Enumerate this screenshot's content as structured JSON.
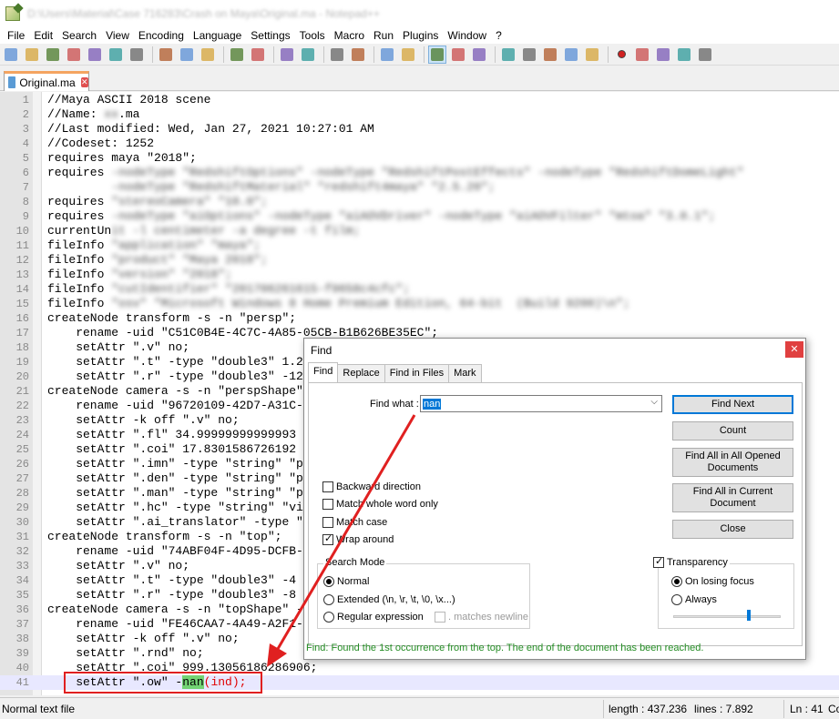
{
  "window": {
    "title": "D:\\Users\\Material\\Case 716283\\Crash on Maya\\Original.ma - Notepad++"
  },
  "menu": [
    "File",
    "Edit",
    "Search",
    "View",
    "Encoding",
    "Language",
    "Settings",
    "Tools",
    "Macro",
    "Run",
    "Plugins",
    "Window",
    "?"
  ],
  "toolbar": {
    "icons": [
      "new-file-icon",
      "open-file-icon",
      "save-icon",
      "save-all-icon",
      "close-icon",
      "close-all-icon",
      "print-icon",
      "cut-icon",
      "copy-icon",
      "paste-icon",
      "undo-icon",
      "redo-icon",
      "find-icon",
      "replace-icon",
      "zoom-in-icon",
      "zoom-out-icon",
      "sync-vertical-icon",
      "sync-horizontal-icon",
      "word-wrap-icon",
      "show-all-chars-icon",
      "indent-guide-icon",
      "udl-icon",
      "doc-map-icon",
      "function-list-icon",
      "folder-workspace-icon",
      "monitoring-icon",
      "record-macro-icon",
      "stop-record-icon",
      "play-macro-icon",
      "run-macro-multiple-icon",
      "save-macro-icon"
    ]
  },
  "tab": {
    "label": "Original.ma"
  },
  "editor": {
    "lines": [
      {
        "n": "1",
        "t": "//Maya ASCII 2018 scene"
      },
      {
        "n": "2",
        "t": "//Name: ",
        "b": "xx",
        "a": ".ma"
      },
      {
        "n": "3",
        "t": "//Last modified: Wed, Jan 27, 2021 10:27:01 AM"
      },
      {
        "n": "4",
        "t": "//Codeset: 1252"
      },
      {
        "n": "5",
        "t": "requires maya \"2018\";"
      },
      {
        "n": "6",
        "t": "requires ",
        "b": "-nodeType \"RedshiftOptions\" -nodeType \"RedshiftPostEffects\" -nodeType \"RedshiftDomeLight\""
      },
      {
        "n": "7",
        "t": "         ",
        "b": "-nodeType \"RedshiftMaterial\" \"redshift4maya\" \"2.5.20\";"
      },
      {
        "n": "8",
        "t": "requires ",
        "b": "\"stereoCamera\" \"10.0\";"
      },
      {
        "n": "9",
        "t": "requires ",
        "b": "-nodeType \"aiOptions\" -nodeType \"aiAOVDriver\" -nodeType \"aiAOVFilter\" \"mtoa\" \"3.0.1\";"
      },
      {
        "n": "10",
        "t": "currentUn",
        "b": "it -l centimeter -a degree -t film;"
      },
      {
        "n": "11",
        "t": "fileInfo ",
        "b": "\"application\" \"maya\";"
      },
      {
        "n": "12",
        "t": "fileInfo ",
        "b": "\"product\" \"Maya 2018\";"
      },
      {
        "n": "13",
        "t": "fileInfo ",
        "b": "\"version\" \"2018\";"
      },
      {
        "n": "14",
        "t": "fileInfo ",
        "b": "\"cutIdentifier\" \"201706261615-f9658c4cfc\";"
      },
      {
        "n": "15",
        "t": "fileInfo ",
        "b": "\"osv\" \"Microsoft Windows 8 Home Premium Edition, 64-bit  (Build 9200)\\n\";"
      },
      {
        "n": "16",
        "t": "createNode transform -s -n \"persp\";"
      },
      {
        "n": "17",
        "t": "    rename -uid \"C51C0B4E-4C7C-4A85-05CB-B1B626BE35EC\";"
      },
      {
        "n": "18",
        "t": "    setAttr \".v\" no;"
      },
      {
        "n": "19",
        "t": "    setAttr \".t\" -type \"double3\" 1.2"
      },
      {
        "n": "20",
        "t": "    setAttr \".r\" -type \"double3\" -12"
      },
      {
        "n": "21",
        "t": "createNode camera -s -n \"perspShape\""
      },
      {
        "n": "22",
        "t": "    rename -uid \"96720109-42D7-A31C-"
      },
      {
        "n": "23",
        "t": "    setAttr -k off \".v\" no;"
      },
      {
        "n": "24",
        "t": "    setAttr \".fl\" 34.99999999999993"
      },
      {
        "n": "25",
        "t": "    setAttr \".coi\" 17.8301586726192"
      },
      {
        "n": "26",
        "t": "    setAttr \".imn\" -type \"string\" \"p"
      },
      {
        "n": "27",
        "t": "    setAttr \".den\" -type \"string\" \"p"
      },
      {
        "n": "28",
        "t": "    setAttr \".man\" -type \"string\" \"p"
      },
      {
        "n": "29",
        "t": "    setAttr \".hc\" -type \"string\" \"vi"
      },
      {
        "n": "30",
        "t": "    setAttr \".ai_translator\" -type \""
      },
      {
        "n": "31",
        "t": "createNode transform -s -n \"top\";"
      },
      {
        "n": "32",
        "t": "    rename -uid \"74ABF04F-4D95-DCFB-"
      },
      {
        "n": "33",
        "t": "    setAttr \".v\" no;"
      },
      {
        "n": "34",
        "t": "    setAttr \".t\" -type \"double3\" -4"
      },
      {
        "n": "35",
        "t": "    setAttr \".r\" -type \"double3\" -8"
      },
      {
        "n": "36",
        "t": "createNode camera -s -n \"topShape\" -"
      },
      {
        "n": "37",
        "t": "    rename -uid \"FE46CAA7-4A49-A2F1-"
      },
      {
        "n": "38",
        "t": "    setAttr -k off \".v\" no;"
      },
      {
        "n": "39",
        "t": "    setAttr \".rnd\" no;"
      },
      {
        "n": "40",
        "t": "    setAttr \".coi\" 999.13056186286906;"
      }
    ],
    "last_line": {
      "n": "41",
      "pre": "    setAttr \".ow\" -",
      "match": "nan",
      "post": "(ind);"
    }
  },
  "find_dialog": {
    "title": "Find",
    "tabs": [
      "Find",
      "Replace",
      "Find in Files",
      "Mark"
    ],
    "find_what_label": "Find what :",
    "find_what_value": "nan",
    "buttons": {
      "find_next": "Find Next",
      "count": "Count",
      "find_all_opened": "Find All in All Opened Documents",
      "find_all_current": "Find All in Current Document",
      "close": "Close"
    },
    "options": {
      "backward": "Backward direction",
      "whole_word": "Match whole word only",
      "match_case": "Match case",
      "wrap_around": "Wrap around"
    },
    "search_mode": {
      "title": "Search Mode",
      "normal": "Normal",
      "extended": "Extended (\\n, \\r, \\t, \\0, \\x...)",
      "regex": "Regular expression",
      "matches_newline": ". matches newline"
    },
    "transparency": {
      "title": "Transparency",
      "on_losing_focus": "On losing focus",
      "always": "Always",
      "level": 0.7
    },
    "status": "Find: Found the 1st occurrence from the top. The end of the document has been reached."
  },
  "statusbar": {
    "file_type": "Normal text file",
    "length": "length : 437.236",
    "lines": "lines : 7.892",
    "ln": "Ln : 41",
    "col": "Co"
  },
  "colors": {
    "match_highlight": "#73d373",
    "annotation_red": "#e02020",
    "status_green": "#228b22"
  }
}
